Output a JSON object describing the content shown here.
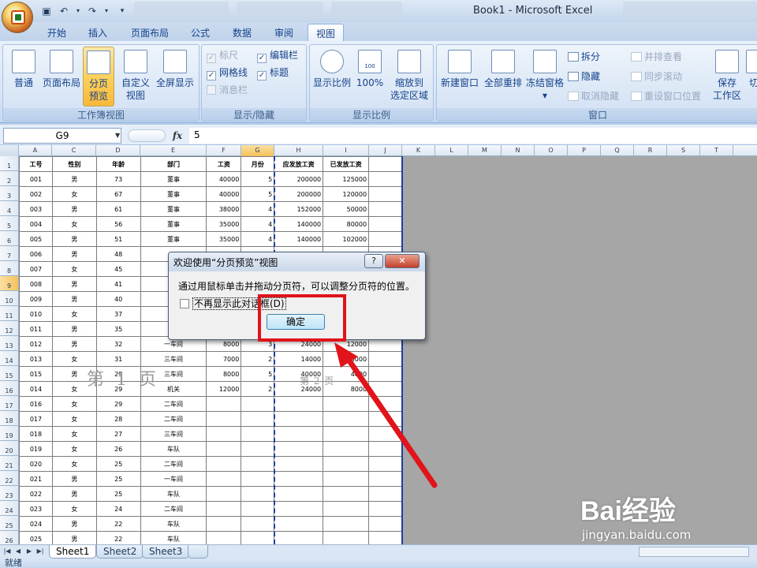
{
  "window": {
    "title": "Book1 - Microsoft Excel"
  },
  "quick_access": {
    "save_icon": "save-icon",
    "undo_icon": "undo-icon",
    "redo_icon": "redo-icon",
    "customize_icon": "chevron-down-icon"
  },
  "ribbon_tabs": [
    "开始",
    "插入",
    "页面布局",
    "公式",
    "数据",
    "审阅",
    "视图"
  ],
  "active_tab": "视图",
  "ribbon": {
    "workbook_views": {
      "label": "工作簿视图",
      "normal": "普通",
      "page_layout": "页面布局",
      "page_break_preview_1": "分页",
      "page_break_preview_2": "预览",
      "custom_views_1": "自定义",
      "custom_views_2": "视图",
      "full_screen": "全屏显示"
    },
    "show_hide": {
      "label": "显示/隐藏",
      "ruler": "标尺",
      "gridlines": "网格线",
      "message_bar": "消息栏",
      "formula_bar": "编辑栏",
      "headings": "标题",
      "ruler_checked": "✓",
      "gridlines_checked": "✓",
      "formula_bar_checked": "✓",
      "headings_checked": "✓"
    },
    "zoom": {
      "label": "显示比例",
      "zoom": "显示比例",
      "hundred": "100%",
      "zoom_to_selection_1": "缩放到",
      "zoom_to_selection_2": "选定区域",
      "hundred_icon_text": "100"
    },
    "window_group": {
      "label": "窗口",
      "new_window": "新建窗口",
      "arrange_all": "全部重排",
      "freeze_panes": "冻结窗格",
      "split": "拆分",
      "hide": "隐藏",
      "unhide": "取消隐藏",
      "view_side_by_side": "并排查看",
      "sync_scroll": "同步滚动",
      "reset_position": "重设窗口位置",
      "save_workspace_1": "保存",
      "save_workspace_2": "工作区",
      "switch_windows": "切"
    }
  },
  "formula_bar": {
    "name_box": "G9",
    "fx": "fx",
    "formula": "5"
  },
  "columns": [
    "A",
    "C",
    "D",
    "E",
    "F",
    "G",
    "H",
    "I",
    "J",
    "K",
    "L",
    "M",
    "N",
    "O",
    "P",
    "Q",
    "R",
    "S",
    "T"
  ],
  "selected_column": "G",
  "row_numbers": [
    "1",
    "2",
    "3",
    "4",
    "5",
    "6",
    "7",
    "8",
    "9",
    "10",
    "11",
    "12",
    "13",
    "14",
    "15",
    "16",
    "17",
    "18",
    "19",
    "20",
    "21",
    "22",
    "23",
    "24",
    "25",
    "26"
  ],
  "selected_row": "9",
  "table": {
    "headers": [
      "工号",
      "性别",
      "年龄",
      "部门",
      "工资",
      "月份",
      "应发放工资",
      "已发放工资"
    ],
    "rows": [
      [
        "001",
        "男",
        "73",
        "董事",
        "40000",
        "5",
        "200000",
        "125000"
      ],
      [
        "002",
        "女",
        "67",
        "董事",
        "40000",
        "5",
        "200000",
        "120000"
      ],
      [
        "003",
        "男",
        "61",
        "董事",
        "38000",
        "4",
        "152000",
        "50000"
      ],
      [
        "004",
        "女",
        "56",
        "董事",
        "35000",
        "4",
        "140000",
        "80000"
      ],
      [
        "005",
        "男",
        "51",
        "董事",
        "35000",
        "4",
        "140000",
        "102000"
      ],
      [
        "006",
        "男",
        "48",
        "",
        "",
        "",
        "",
        ""
      ],
      [
        "007",
        "女",
        "45",
        "",
        "",
        "",
        "",
        ""
      ],
      [
        "008",
        "男",
        "41",
        "",
        "",
        "",
        "",
        ""
      ],
      [
        "009",
        "男",
        "40",
        "",
        "",
        "",
        "",
        ""
      ],
      [
        "010",
        "女",
        "37",
        "",
        "",
        "",
        "",
        ""
      ],
      [
        "011",
        "男",
        "35",
        "",
        "",
        "",
        "",
        ""
      ],
      [
        "012",
        "男",
        "32",
        "一车间",
        "8000",
        "3",
        "24000",
        "12000"
      ],
      [
        "013",
        "女",
        "31",
        "三车间",
        "7000",
        "2",
        "14000",
        "5000"
      ],
      [
        "015",
        "男",
        "29",
        "三车间",
        "8000",
        "5",
        "40000",
        "4000"
      ],
      [
        "014",
        "女",
        "29",
        "机关",
        "12000",
        "2",
        "24000",
        "8000"
      ],
      [
        "016",
        "女",
        "29",
        "二车间",
        "",
        "",
        "",
        ""
      ],
      [
        "017",
        "女",
        "28",
        "二车间",
        "",
        "",
        "",
        ""
      ],
      [
        "018",
        "女",
        "27",
        "三车间",
        "",
        "",
        "",
        ""
      ],
      [
        "019",
        "女",
        "26",
        "车队",
        "",
        "",
        "",
        ""
      ],
      [
        "020",
        "女",
        "25",
        "二车间",
        "",
        "",
        "",
        ""
      ],
      [
        "021",
        "男",
        "25",
        "一车间",
        "",
        "",
        "",
        ""
      ],
      [
        "022",
        "男",
        "25",
        "车队",
        "",
        "",
        "",
        ""
      ],
      [
        "023",
        "女",
        "24",
        "二车间",
        "",
        "",
        "",
        ""
      ],
      [
        "024",
        "男",
        "22",
        "车队",
        "",
        "",
        "",
        ""
      ],
      [
        "025",
        "男",
        "22",
        "车队",
        "",
        "",
        "",
        ""
      ]
    ]
  },
  "page_labels": {
    "page1": "第 1 页",
    "page2": "第 2 页"
  },
  "dialog": {
    "title": "欢迎使用“分页预览”视图",
    "help": "?",
    "close": "✕",
    "message": "通过用鼠标单击并拖动分页符，可以调整分页符的位置。",
    "checkbox_label": "不再显示此对话框(D)",
    "ok": "确定"
  },
  "sheet_tabs": [
    "Sheet1",
    "Sheet2",
    "Sheet3"
  ],
  "active_sheet": "Sheet1",
  "sheet_nav": [
    "|◀",
    "◀",
    "▶",
    "▶|"
  ],
  "status": "就绪",
  "watermark": {
    "brand": "Bai经验",
    "url": "jingyan.baidu.com"
  },
  "colors": {
    "highlight_box": "#e0141a",
    "arrow": "#e0141a",
    "page_break": "#1f3fa0",
    "ribbon_active": "#fbd15c"
  }
}
